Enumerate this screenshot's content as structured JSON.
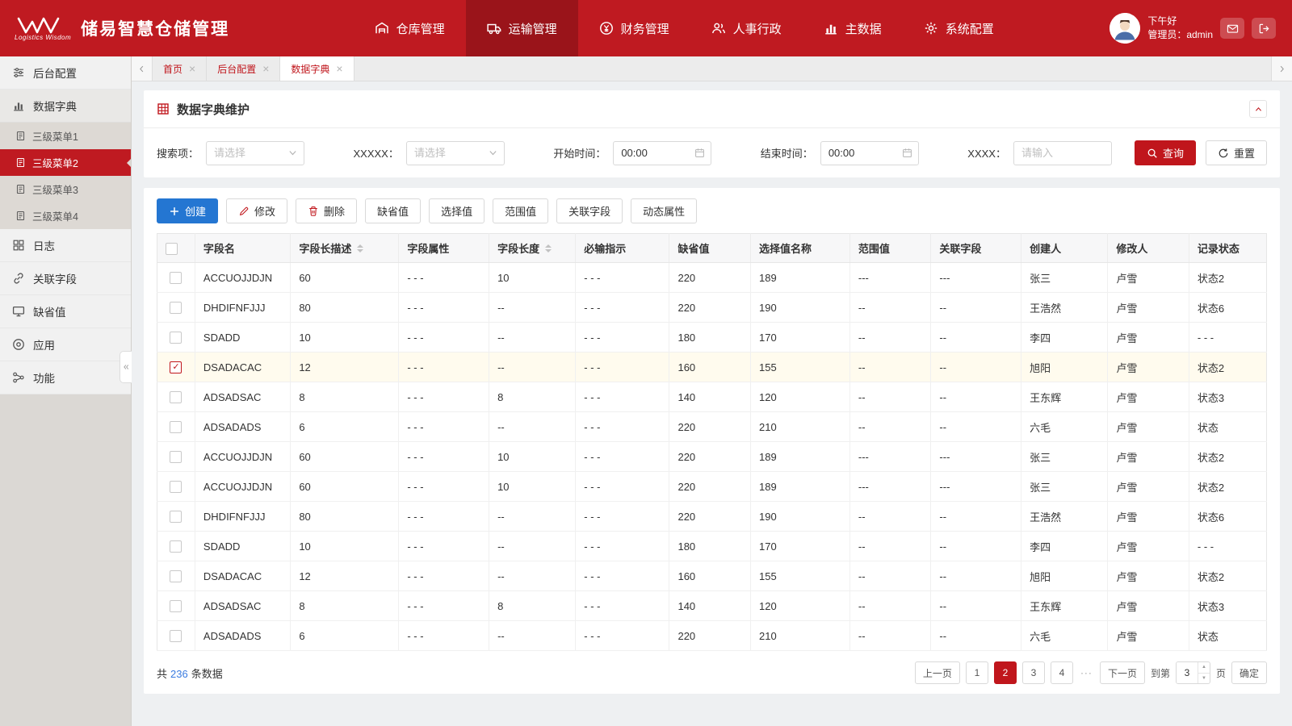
{
  "brand": {
    "title": "储易智慧仓储管理",
    "tagline": "Logistics Wisdom"
  },
  "top_nav": [
    {
      "name": "warehouse",
      "label": "仓库管理",
      "icon": "warehouse-icon",
      "active": false
    },
    {
      "name": "transport",
      "label": "运输管理",
      "icon": "truck-icon",
      "active": true
    },
    {
      "name": "finance",
      "label": "财务管理",
      "icon": "finance-icon",
      "active": false
    },
    {
      "name": "hr-admin",
      "label": "人事行政",
      "icon": "hr-icon",
      "active": false
    },
    {
      "name": "master-data",
      "label": "主数据",
      "icon": "master-data-icon",
      "active": false
    },
    {
      "name": "system-config",
      "label": "系统配置",
      "icon": "settings-icon",
      "active": false
    }
  ],
  "user": {
    "greeting": "下午好",
    "role_line": "管理员：admin"
  },
  "sidebar": {
    "items": [
      {
        "name": "backend-config",
        "label": "后台配置",
        "icon": "sliders-icon"
      },
      {
        "name": "data-dictionary",
        "label": "数据字典",
        "icon": "bar-chart-icon",
        "group": true,
        "children": [
          {
            "name": "level3-menu-1",
            "label": "三级菜单1",
            "active": false
          },
          {
            "name": "level3-menu-2",
            "label": "三级菜单2",
            "active": true
          },
          {
            "name": "level3-menu-3",
            "label": "三级菜单3",
            "active": false
          },
          {
            "name": "level3-menu-4",
            "label": "三级菜单4",
            "active": false
          }
        ]
      },
      {
        "name": "logs",
        "label": "日志",
        "icon": "grid-icon"
      },
      {
        "name": "related-fields",
        "label": "关联字段",
        "icon": "link-icon"
      },
      {
        "name": "default-values",
        "label": "缺省值",
        "icon": "monitor-icon"
      },
      {
        "name": "applications",
        "label": "应用",
        "icon": "app-icon"
      },
      {
        "name": "functions",
        "label": "功能",
        "icon": "nodes-icon"
      }
    ]
  },
  "tabs": [
    {
      "name": "home",
      "label": "首页",
      "active": false
    },
    {
      "name": "backend-config",
      "label": "后台配置",
      "active": false
    },
    {
      "name": "data-dictionary",
      "label": "数据字典",
      "active": true
    }
  ],
  "panel": {
    "title": "数据字典维护"
  },
  "filters": {
    "fields": [
      {
        "name": "search-item",
        "label": "搜索项：",
        "type": "select",
        "placeholder": "请选择"
      },
      {
        "name": "xxxxx",
        "label": "XXXXX：",
        "type": "select",
        "placeholder": "请选择"
      },
      {
        "name": "start-time",
        "label": "开始时间：",
        "type": "time",
        "value": "00:00"
      },
      {
        "name": "end-time",
        "label": "结束时间：",
        "type": "time",
        "value": "00:00"
      },
      {
        "name": "xxxx",
        "label": "XXXX：",
        "type": "text",
        "placeholder": "请输入"
      }
    ],
    "search_label": "查询",
    "reset_label": "重置"
  },
  "toolbar": [
    {
      "name": "create",
      "label": "创建",
      "icon": "plus-icon",
      "style": "primary"
    },
    {
      "name": "edit",
      "label": "修改",
      "icon": "edit-icon",
      "icon_color": "red",
      "style": "default"
    },
    {
      "name": "delete",
      "label": "删除",
      "icon": "delete-icon",
      "icon_color": "red",
      "style": "default"
    },
    {
      "name": "default-value",
      "label": "缺省值",
      "style": "default"
    },
    {
      "name": "select-value",
      "label": "选择值",
      "style": "default"
    },
    {
      "name": "range-value",
      "label": "范围值",
      "style": "default"
    },
    {
      "name": "related-field",
      "label": "关联字段",
      "style": "default"
    },
    {
      "name": "dynamic-attribute",
      "label": "动态属性",
      "style": "default"
    }
  ],
  "table": {
    "columns": [
      {
        "label": "字段名"
      },
      {
        "label": "字段长描述",
        "sortable": true
      },
      {
        "label": "字段属性"
      },
      {
        "label": "字段长度",
        "sortable": true
      },
      {
        "label": "必输指示"
      },
      {
        "label": "缺省值"
      },
      {
        "label": "选择值名称"
      },
      {
        "label": "范围值"
      },
      {
        "label": "关联字段"
      },
      {
        "label": "创建人"
      },
      {
        "label": "修改人"
      },
      {
        "label": "记录状态"
      }
    ],
    "rows": [
      {
        "checked": false,
        "cells": [
          "ACCUOJJDJN",
          "60",
          "- - -",
          "10",
          "- - -",
          "220",
          "189",
          "---",
          "---",
          "张三",
          "卢雪",
          "状态2"
        ]
      },
      {
        "checked": false,
        "cells": [
          "DHDIFNFJJJ",
          "80",
          "- - -",
          "--",
          "- - -",
          "220",
          "190",
          "--",
          "--",
          "王浩然",
          "卢雪",
          "状态6"
        ]
      },
      {
        "checked": false,
        "cells": [
          "SDADD",
          "10",
          "- - -",
          "--",
          "- - -",
          "180",
          "170",
          "--",
          "--",
          "李四",
          "卢雪",
          "- - -"
        ]
      },
      {
        "checked": true,
        "cells": [
          "DSADACAC",
          "12",
          "- - -",
          "--",
          "- - -",
          "160",
          "155",
          "--",
          "--",
          "旭阳",
          "卢雪",
          "状态2"
        ]
      },
      {
        "checked": false,
        "cells": [
          "ADSADSAC",
          "8",
          "- - -",
          "8",
          "- - -",
          "140",
          "120",
          "--",
          "--",
          "王东辉",
          "卢雪",
          "状态3"
        ]
      },
      {
        "checked": false,
        "cells": [
          "ADSADADS",
          "6",
          "- - -",
          "--",
          "- - -",
          "220",
          "210",
          "--",
          "--",
          "六毛",
          "卢雪",
          "状态"
        ]
      },
      {
        "checked": false,
        "cells": [
          "ACCUOJJDJN",
          "60",
          "- - -",
          "10",
          "- - -",
          "220",
          "189",
          "---",
          "---",
          "张三",
          "卢雪",
          "状态2"
        ]
      },
      {
        "checked": false,
        "cells": [
          "ACCUOJJDJN",
          "60",
          "- - -",
          "10",
          "- - -",
          "220",
          "189",
          "---",
          "---",
          "张三",
          "卢雪",
          "状态2"
        ]
      },
      {
        "checked": false,
        "cells": [
          "DHDIFNFJJJ",
          "80",
          "- - -",
          "--",
          "- - -",
          "220",
          "190",
          "--",
          "--",
          "王浩然",
          "卢雪",
          "状态6"
        ]
      },
      {
        "checked": false,
        "cells": [
          "SDADD",
          "10",
          "- - -",
          "--",
          "- - -",
          "180",
          "170",
          "--",
          "--",
          "李四",
          "卢雪",
          "- - -"
        ]
      },
      {
        "checked": false,
        "cells": [
          "DSADACAC",
          "12",
          "- - -",
          "--",
          "- - -",
          "160",
          "155",
          "--",
          "--",
          "旭阳",
          "卢雪",
          "状态2"
        ]
      },
      {
        "checked": false,
        "cells": [
          "ADSADSAC",
          "8",
          "- - -",
          "8",
          "- - -",
          "140",
          "120",
          "--",
          "--",
          "王东辉",
          "卢雪",
          "状态3"
        ]
      },
      {
        "checked": false,
        "cells": [
          "ADSADADS",
          "6",
          "- - -",
          "--",
          "- - -",
          "220",
          "210",
          "--",
          "--",
          "六毛",
          "卢雪",
          "状态"
        ]
      }
    ]
  },
  "footer": {
    "total_prefix": "共",
    "total_count": "236",
    "total_suffix": "条数据",
    "pagination": {
      "prev": "上一页",
      "pages": [
        "1",
        "2",
        "3",
        "4"
      ],
      "active_page": "2",
      "ellipsis": "···",
      "next": "下一页",
      "jump_prefix": "到第",
      "jump_value": "3",
      "jump_suffix": "页",
      "confirm": "确定"
    }
  },
  "colors": {
    "primary_red": "#bf1a21",
    "active_nav_red": "#9a141a",
    "primary_blue": "#2476d2",
    "link_blue": "#3a7be0",
    "selected_row": "#fffbee"
  }
}
